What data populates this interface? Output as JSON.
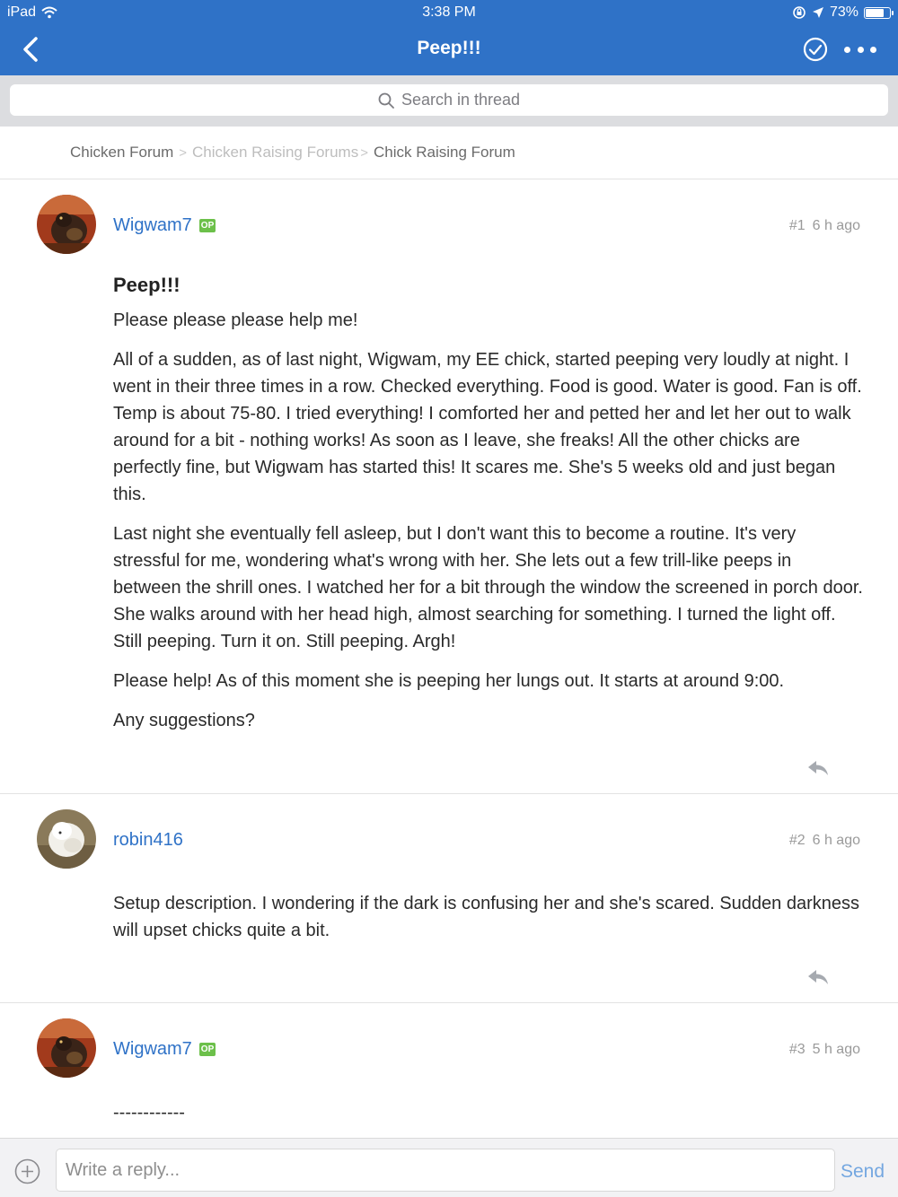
{
  "status_bar": {
    "device": "iPad",
    "time": "3:38 PM",
    "battery_text": "73%",
    "battery_level": 0.73
  },
  "nav": {
    "title": "Peep!!!"
  },
  "search": {
    "placeholder": "Search in thread"
  },
  "breadcrumb": [
    {
      "label": "Chicken Forum"
    },
    {
      "label": "Chicken Raising Forums"
    },
    {
      "label": "Chick Raising Forum"
    }
  ],
  "posts": [
    {
      "username": "Wigwam7",
      "badge": "OP",
      "number": "#1",
      "time": "6 h ago",
      "title": "Peep!!!",
      "paragraphs": [
        "Please please please help me!",
        "All of a sudden, as of last night, Wigwam, my EE chick, started peeping very loudly at night. I went in their three times in a row. Checked everything. Food is good. Water is good. Fan is off. Temp is about 75-80. I tried everything! I comforted her and petted her and let her out to walk around for a bit - nothing works! As soon as I leave, she freaks! All the other chicks are perfectly fine, but Wigwam has started this! It scares me. She's 5 weeks old and just began this.",
        "Last night she eventually fell asleep, but I don't want this to become a routine. It's very stressful for me, wondering what's wrong with her. She lets out a few trill-like peeps in between the shrill ones. I watched her for a bit through the window the screened in porch door. She walks around with her head high, almost searching for something. I turned the light off. Still peeping. Turn it on. Still peeping. Argh!",
        "Please help! As of this moment she is peeping her lungs out. It starts at around 9:00.",
        "Any suggestions?"
      ]
    },
    {
      "username": "robin416",
      "number": "#2",
      "time": "6 h ago",
      "paragraphs": [
        "Setup description. I wondering if the dark is confusing her and she's scared. Sudden darkness will upset chicks quite a bit."
      ]
    },
    {
      "username": "Wigwam7",
      "badge": "OP",
      "number": "#3",
      "time": "5 h ago",
      "paragraphs": [
        "------------"
      ]
    }
  ],
  "reply_bar": {
    "placeholder": "Write a reply...",
    "send_label": "Send"
  },
  "colors": {
    "nav_blue": "#2f72c7",
    "op_badge": "#6cc04a",
    "link": "#2f72c7",
    "send": "#74a7e0"
  },
  "icons": [
    "wifi-icon",
    "back-chevron-icon",
    "check-circle-icon",
    "more-icon",
    "search-icon",
    "reply-icon",
    "plus-circle-icon",
    "location-arrow-icon",
    "rotation-lock-icon",
    "battery-icon"
  ]
}
